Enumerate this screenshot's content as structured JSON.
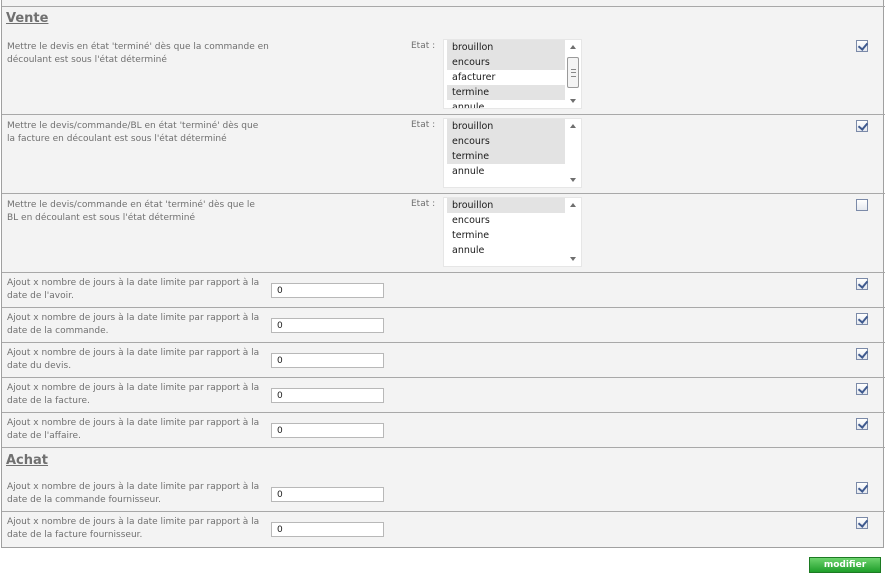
{
  "vente": {
    "title": "Vente",
    "rows": [
      {
        "description": "Mettre le devis en état 'terminé' dès que la commande en découlant est sous l'état déterminé",
        "etat_label": "Etat :",
        "options": [
          {
            "label": "brouillon",
            "selected": true
          },
          {
            "label": "encours",
            "selected": true
          },
          {
            "label": "afacturer",
            "selected": false
          },
          {
            "label": "termine",
            "selected": true
          },
          {
            "label": "annule",
            "selected": false
          }
        ],
        "checked": true
      },
      {
        "description": "Mettre le devis/commande/BL en état 'terminé' dès que la facture en découlant est sous l'état déterminé",
        "etat_label": "Etat :",
        "options": [
          {
            "label": "brouillon",
            "selected": true
          },
          {
            "label": "encours",
            "selected": true
          },
          {
            "label": "termine",
            "selected": true
          },
          {
            "label": "annule",
            "selected": false
          }
        ],
        "checked": true
      },
      {
        "description": "Mettre le devis/commande en état 'terminé' dès que le BL en découlant est sous l'état déterminé",
        "etat_label": "Etat :",
        "options": [
          {
            "label": "brouillon",
            "selected": true
          },
          {
            "label": "encours",
            "selected": false
          },
          {
            "label": "termine",
            "selected": false
          },
          {
            "label": "annule",
            "selected": false
          }
        ],
        "checked": false
      }
    ],
    "day_rows": [
      {
        "description": "Ajout x nombre de jours à la date limite par rapport à la date de l'avoir.",
        "value": "0",
        "checked": true
      },
      {
        "description": "Ajout x nombre de jours à la date limite par rapport à la date de la commande.",
        "value": "0",
        "checked": true
      },
      {
        "description": "Ajout x nombre de jours à la date limite par rapport à la date du devis.",
        "value": "0",
        "checked": true
      },
      {
        "description": "Ajout x nombre de jours à la date limite par rapport à la date de la facture.",
        "value": "0",
        "checked": true
      },
      {
        "description": "Ajout x nombre de jours à la date limite par rapport à la date de l'affaire.",
        "value": "0",
        "checked": true
      }
    ]
  },
  "achat": {
    "title": "Achat",
    "day_rows": [
      {
        "description": "Ajout x nombre de jours à la date limite par rapport à la date de la commande fournisseur.",
        "value": "0",
        "checked": true
      },
      {
        "description": "Ajout x nombre de jours à la date limite par rapport à la date de la facture fournisseur.",
        "value": "0",
        "checked": true
      }
    ]
  },
  "submit_label": "modifier",
  "colors": {
    "panel_bg": "#f3f3f3",
    "border": "#a8a8a8",
    "text": "#707070",
    "button_green": "#2fae37"
  }
}
